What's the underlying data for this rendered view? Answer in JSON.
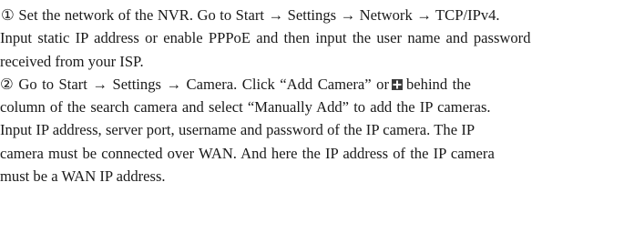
{
  "step1": {
    "line1": "① Set the network of the NVR. Go to Start → Settings → Network → TCP/IPv4.",
    "line2": "Input static IP address or enable PPPoE and then input the user name and password",
    "line3": "received from your ISP."
  },
  "step2": {
    "line1_before_icon": "② Go to Start → Settings → Camera. Click “Add Camera” or",
    "line1_after_icon": "behind the",
    "icon": "add-camera-plus-icon",
    "line2": "column of the search camera and select “Manually Add” to add the IP cameras.",
    "line3": "Input IP address, server port, username and password of the IP camera. The IP",
    "line4": "camera must be connected over WAN. And here the IP address of the IP camera",
    "line5": "must be a WAN IP address."
  },
  "colors": {
    "text": "#1a1a1a",
    "icon": "#3c3c3c"
  }
}
